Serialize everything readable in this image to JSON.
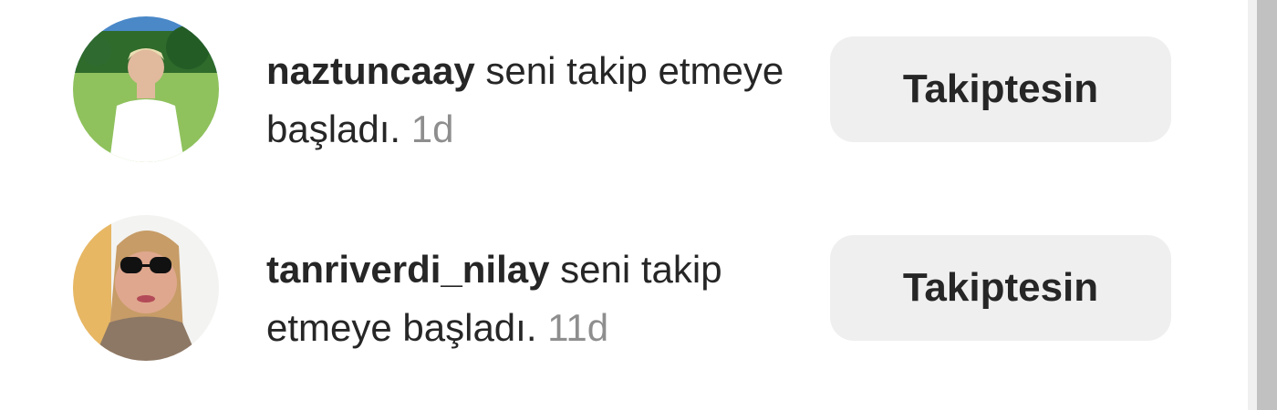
{
  "notifications": [
    {
      "username": "naztuncaay",
      "message": " seni takip etmeye başladı. ",
      "time": "1d",
      "button_label": "Takiptesin"
    },
    {
      "username": "tanriverdi_nilay",
      "message": " seni takip etmeye başladı. ",
      "time": "11d",
      "button_label": "Takiptesin"
    }
  ],
  "colors": {
    "text": "#262626",
    "muted": "#8e8e8e",
    "button_background": "#efefef",
    "scrollbar_track": "#f0f0f0",
    "scrollbar_thumb": "#c1c1c1"
  }
}
